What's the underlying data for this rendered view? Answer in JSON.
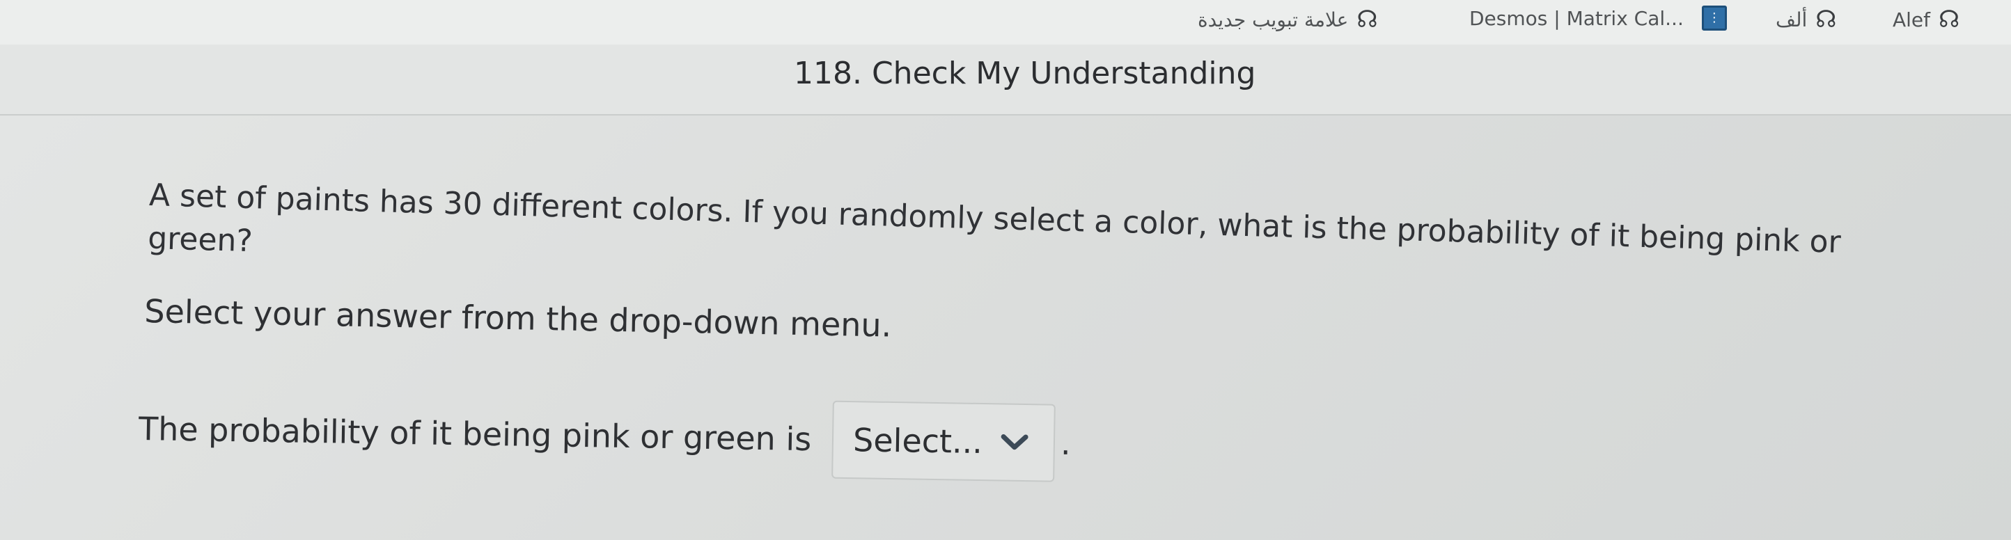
{
  "bookmarks_bar": {
    "items": [
      {
        "label": "علامة تبويب جديدة"
      },
      {
        "label": "Desmos | Matrix Cal..."
      },
      {
        "label": "ألف"
      },
      {
        "label": "Alef"
      }
    ]
  },
  "item": {
    "title": "118. Check My Understanding"
  },
  "question": {
    "text": "A set of paints has 30 different colors. If you randomly select a color, what is the probability of it being pink or green?",
    "instruction": "Select your answer from the drop-down menu."
  },
  "answer": {
    "prefix": "The probability of it being pink or green is",
    "dropdown": {
      "selected": "Select..."
    },
    "suffix": "."
  },
  "icons": {
    "bookmark": "bookmark-page-icon",
    "dropdown": "chevron-down-icon"
  }
}
